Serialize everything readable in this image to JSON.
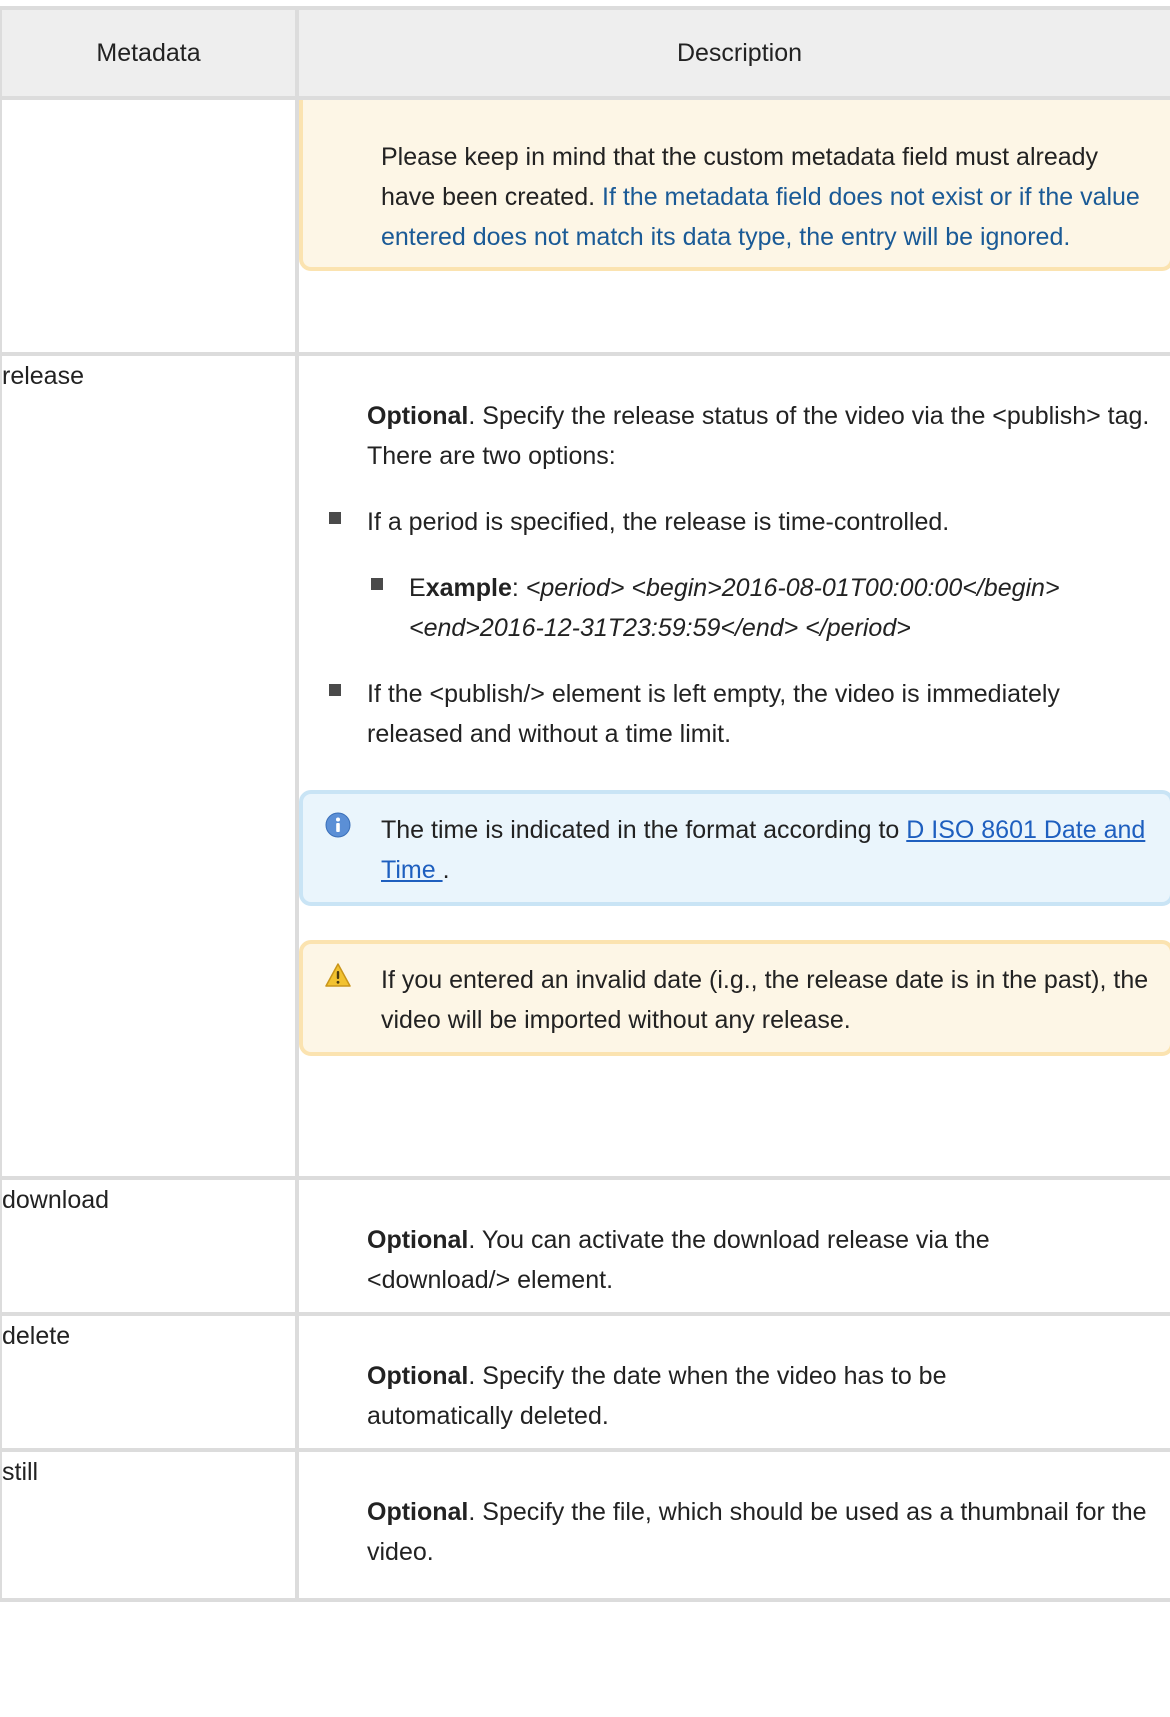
{
  "table": {
    "headers": {
      "col1": "Metadata",
      "col2": "Description"
    },
    "top_note": {
      "plain": "Please keep in mind that the custom metadata field must already have been created.",
      "blue": "If the metadata field does not exist or if the value entered does not match its data type, the entry will be ignored."
    },
    "release": {
      "key": "release",
      "optional": "Optional",
      "intro_rest": ". Specify the release status of the video via the <publish> tag. There are two options:",
      "bullet1": "If a period is specified, the release is time-controlled.",
      "example_prefix": "E",
      "example_bold": "xample",
      "example_colon": ": ",
      "example_code": "<period> <begin>2016-08-01T00:00:00</begin> <end>2016-12-31T23:59:59</end> </period>",
      "bullet2": "If the <publish/> element is left empty, the video is immediately released and without a time limit.",
      "info_before": "The time is indicated in the format according to ",
      "info_link": "D ISO 8601 Date and Time ",
      "info_after": ".",
      "warning": "If you entered an invalid date (i.g., the release date is in the past), the video will be imported without any release."
    },
    "download": {
      "key": "download",
      "optional": "Optional",
      "rest": ". You can activate the download release via the <download/> element."
    },
    "delete": {
      "key": "delete",
      "optional": "Optional",
      "rest": ". Specify the date when the video has to be automatically deleted."
    },
    "still": {
      "key": "still",
      "optional": "Optional",
      "rest": ". Specify the file, which should be used as a thumbnail for the video."
    }
  },
  "colors": {
    "warning_bg": "#fdf6e6",
    "warning_border": "#fbe3b0",
    "info_bg": "#eaf5fc",
    "info_border": "#c9e4f5",
    "link": "#1e5fbf",
    "blue_text": "#1a5a96"
  },
  "icons": {
    "info": "info-icon",
    "warning": "warning-icon"
  }
}
